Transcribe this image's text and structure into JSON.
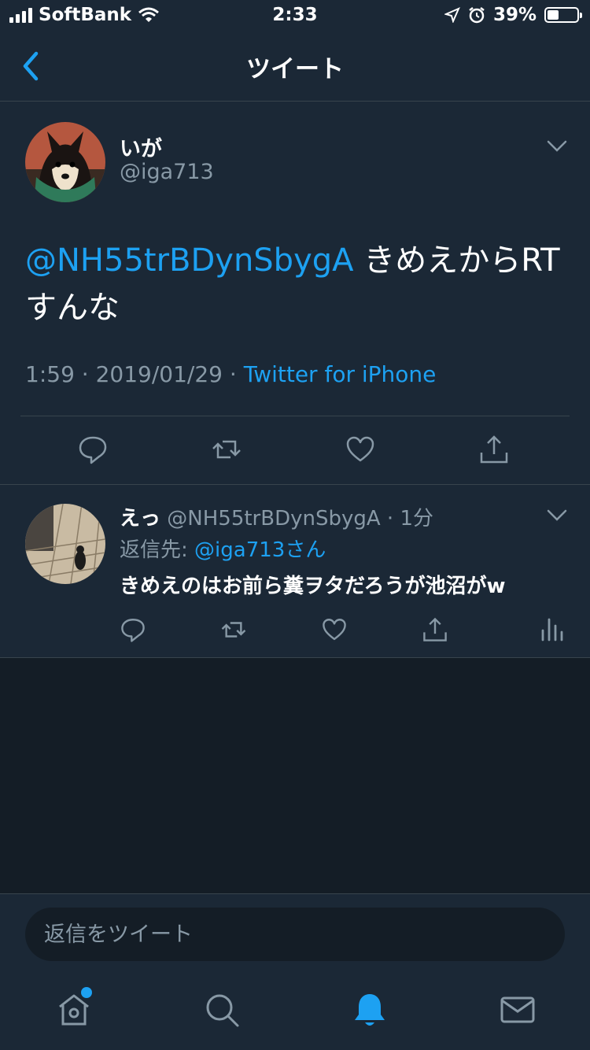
{
  "status_bar": {
    "carrier": "SoftBank",
    "time": "2:33",
    "battery": "39%"
  },
  "header": {
    "title": "ツイート"
  },
  "tweet": {
    "author_name": "いが",
    "author_handle": "@iga713",
    "mention": "@NH55trBDynSbygA",
    "text": " きめえからRT すんな",
    "time": "1:59",
    "date": "2019/01/29",
    "source": "Twitter for iPhone"
  },
  "reply": {
    "author_name": "えっ",
    "author_handle": "@NH55trBDynSbygA",
    "time": "1分",
    "reply_to_prefix": "返信先: ",
    "reply_to_mention": "@iga713さん",
    "text": "きめえのはお前ら糞ヲタだろうが池沼がw"
  },
  "composer": {
    "placeholder": "返信をツイート"
  },
  "colors": {
    "background": "#141d26",
    "panel": "#1b2836",
    "accent": "#1da1f2",
    "muted": "#8899a6"
  }
}
